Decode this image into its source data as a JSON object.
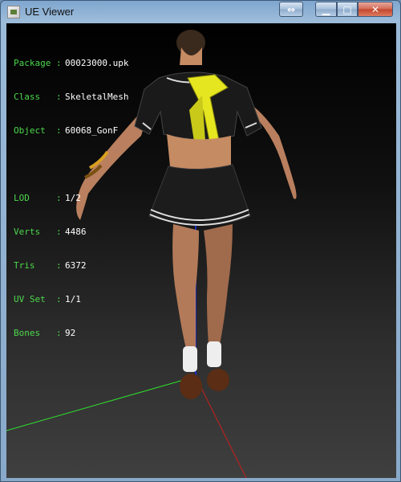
{
  "window": {
    "title": "UE Viewer"
  },
  "info": [
    {
      "label": "Package",
      "value": "00023000.upk"
    },
    {
      "label": "Class",
      "value": "SkeletalMesh"
    },
    {
      "label": "Object",
      "value": "60068_GonF"
    },
    {
      "label": "LOD",
      "value": "1/2"
    },
    {
      "label": "Verts",
      "value": "4486"
    },
    {
      "label": "Tris",
      "value": "6372"
    },
    {
      "label": "UV Set",
      "value": "1/1"
    },
    {
      "label": "Bones",
      "value": "92"
    }
  ],
  "colors": {
    "label": "#4cd94c",
    "value": "#ffffff",
    "axis_x": "#c81e1e",
    "axis_y": "#2ee02e",
    "axis_z": "#1c2bb0",
    "scarf": "#e6e620",
    "uniform": "#1a1a1a"
  }
}
